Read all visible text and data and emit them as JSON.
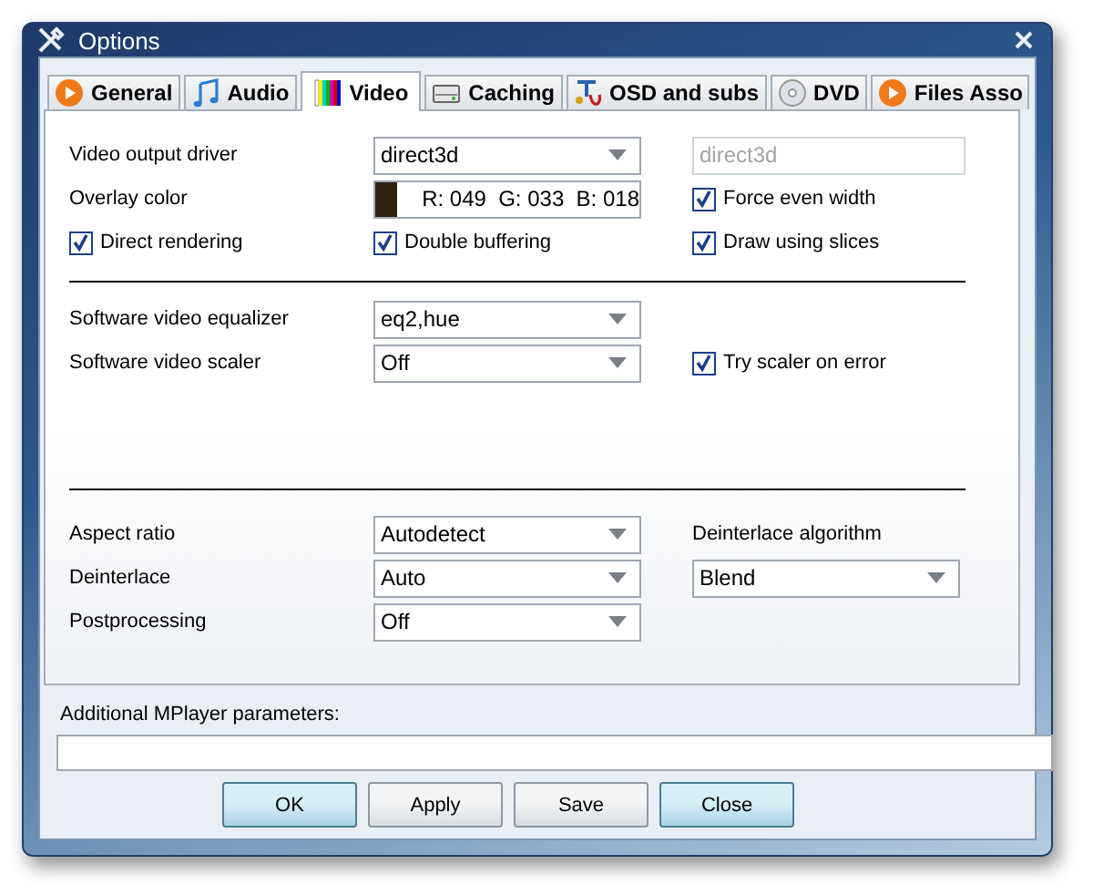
{
  "window": {
    "title": "Options"
  },
  "tabs": [
    {
      "label": "General",
      "kind": "play",
      "selected": false
    },
    {
      "label": "Audio",
      "kind": "note",
      "selected": false
    },
    {
      "label": "Video",
      "kind": "bars",
      "selected": true
    },
    {
      "label": "Caching",
      "kind": "drive",
      "selected": false
    },
    {
      "label": "OSD and subs",
      "kind": "text",
      "selected": false
    },
    {
      "label": "DVD",
      "kind": "disc",
      "selected": false
    },
    {
      "label": "Files Asso",
      "kind": "play",
      "selected": false
    }
  ],
  "sections": [
    {
      "rows": [
        {
          "left": {
            "kind": "label",
            "text": "Video output driver"
          },
          "middle": {
            "kind": "combo",
            "value": "direct3d"
          },
          "right": {
            "kind": "textbox",
            "value": "direct3d",
            "disabled": true
          }
        },
        {
          "left": {
            "kind": "label",
            "text": "Overlay color"
          },
          "middle": {
            "kind": "color",
            "value": "R: 049  G: 033  B: 018",
            "color": "#312112"
          },
          "right": {
            "kind": "checkbox",
            "text": "Force even width",
            "checked": true
          }
        },
        {
          "left": {
            "kind": "checkbox",
            "text": "Direct rendering",
            "checked": true
          },
          "middle": {
            "kind": "checkbox",
            "text": "Double buffering",
            "checked": true
          },
          "right": {
            "kind": "checkbox",
            "text": "Draw using slices",
            "checked": true
          }
        }
      ]
    },
    {
      "rows": [
        {
          "left": {
            "kind": "label",
            "text": "Software video equalizer"
          },
          "middle": {
            "kind": "combo",
            "value": "eq2,hue"
          }
        },
        {
          "left": {
            "kind": "label",
            "text": "Software video scaler"
          },
          "middle": {
            "kind": "combo",
            "value": "Off"
          },
          "right": {
            "kind": "checkbox",
            "text": "Try scaler on error",
            "checked": true
          }
        }
      ]
    },
    {
      "rows": [
        {
          "left": {
            "kind": "label",
            "text": "Aspect ratio"
          },
          "middle": {
            "kind": "combo",
            "value": "Autodetect"
          },
          "right": {
            "kind": "label",
            "text": "Deinterlace algorithm"
          }
        },
        {
          "left": {
            "kind": "label",
            "text": "Deinterlace"
          },
          "middle": {
            "kind": "combo",
            "value": "Auto"
          },
          "right": {
            "kind": "combo",
            "value": "Blend"
          }
        },
        {
          "left": {
            "kind": "label",
            "text": "Postprocessing"
          },
          "middle": {
            "kind": "combo",
            "value": "Off"
          }
        }
      ]
    }
  ],
  "parameters": {
    "label": "Additional MPlayer parameters:"
  },
  "buttons": [
    {
      "label": "OK",
      "highlighted": true
    },
    {
      "label": "Apply",
      "highlighted": false
    },
    {
      "label": "Save",
      "highlighted": false
    },
    {
      "label": "Close",
      "highlighted": true
    }
  ]
}
